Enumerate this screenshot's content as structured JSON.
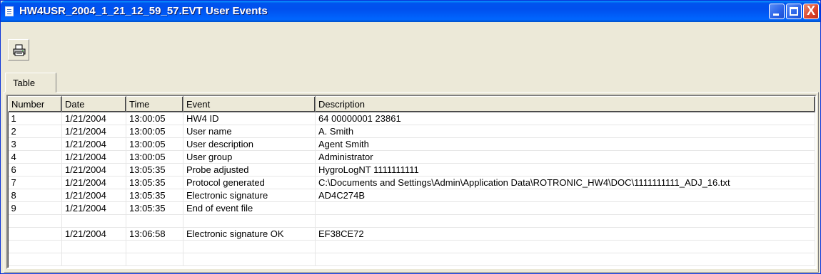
{
  "window": {
    "title": "HW4USR_2004_1_21_12_59_57.EVT  User Events",
    "minimize_label": "",
    "maximize_label": "",
    "close_label": "X"
  },
  "toolbar": {
    "print_icon": "printer-icon"
  },
  "tabs": [
    {
      "label": "Table"
    }
  ],
  "table": {
    "columns": [
      "Number",
      "Date",
      "Time",
      "Event",
      "Description"
    ],
    "rows": [
      [
        "1",
        "1/21/2004",
        "13:00:05",
        "HW4 ID",
        "64 00000001 23861"
      ],
      [
        "2",
        "1/21/2004",
        "13:00:05",
        "User name",
        "A. Smith"
      ],
      [
        "3",
        "1/21/2004",
        "13:00:05",
        "User description",
        "Agent Smith"
      ],
      [
        "4",
        "1/21/2004",
        "13:00:05",
        "User group",
        "Administrator"
      ],
      [
        "6",
        "1/21/2004",
        "13:05:35",
        "Probe adjusted",
        "HygroLogNT  1111111111"
      ],
      [
        "7",
        "1/21/2004",
        "13:05:35",
        "Protocol generated",
        "C:\\Documents and Settings\\Admin\\Application Data\\ROTRONIC_HW4\\DOC\\1111111111_ADJ_16.txt"
      ],
      [
        "8",
        "1/21/2004",
        "13:05:35",
        "Electronic signature",
        "AD4C274B"
      ],
      [
        "9",
        "1/21/2004",
        "13:05:35",
        "End of event file",
        ""
      ],
      [
        "",
        "",
        "",
        "",
        ""
      ],
      [
        "",
        "1/21/2004",
        "13:06:58",
        "Electronic signature OK",
        "EF38CE72"
      ],
      [
        "",
        "",
        "",
        "",
        ""
      ],
      [
        "",
        "",
        "",
        "",
        ""
      ]
    ]
  }
}
